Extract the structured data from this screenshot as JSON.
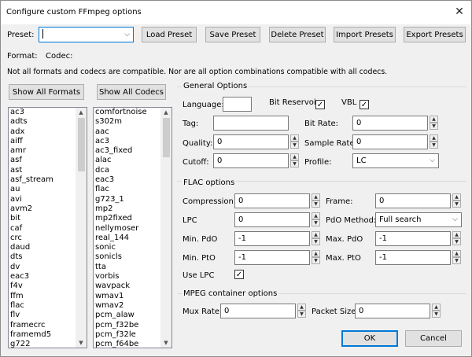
{
  "window": {
    "title": "Configure custom FFmpeg options",
    "close_glyph": "✕"
  },
  "preset": {
    "label": "Preset:",
    "value": "",
    "dropdown_glyph": "⌵"
  },
  "toolbar": {
    "load": "Load Preset",
    "save": "Save Preset",
    "delete": "Delete Preset",
    "import": "Import Presets",
    "export": "Export Presets"
  },
  "format_row": {
    "format_label": "Format:",
    "codec_label": "Codec:"
  },
  "notice": "Not all formats and codecs are compatible. Nor are all option combinations compatible with all codecs.",
  "lists": {
    "show_formats": "Show All Formats",
    "show_codecs": "Show All Codecs",
    "formats": [
      "ac3",
      "adts",
      "adx",
      "aiff",
      "amr",
      "asf",
      "ast",
      "asf_stream",
      "au",
      "avi",
      "avm2",
      "bit",
      "caf",
      "crc",
      "daud",
      "dts",
      "dv",
      "eac3",
      "f4v",
      "ffm",
      "flac",
      "flv",
      "framecrc",
      "framemd5",
      "g722"
    ],
    "codecs": [
      "comfortnoise",
      "s302m",
      "aac",
      "ac3",
      "ac3_fixed",
      "alac",
      "dca",
      "eac3",
      "flac",
      "g723_1",
      "mp2",
      "mp2fixed",
      "nellymoser",
      "real_144",
      "sonic",
      "sonicls",
      "tta",
      "vorbis",
      "wavpack",
      "wmav1",
      "wmav2",
      "pcm_alaw",
      "pcm_f32be",
      "pcm_f32le",
      "pcm_f64be"
    ]
  },
  "general": {
    "title": "General Options",
    "language_label": "Language:",
    "language_value": "",
    "bit_reservoir_label": "Bit Reservoir",
    "bit_reservoir_checked": "✓",
    "vbl_label": "VBL",
    "vbl_checked": "✓",
    "tag_label": "Tag:",
    "tag_value": "",
    "bitrate_label": "Bit Rate:",
    "bitrate_value": "0",
    "quality_label": "Quality:",
    "quality_value": "0",
    "samplerate_label": "Sample Rate:",
    "samplerate_value": "0",
    "cutoff_label": "Cutoff:",
    "cutoff_value": "0",
    "profile_label": "Profile:",
    "profile_value": "LC"
  },
  "flac": {
    "title": "FLAC options",
    "compression_label": "Compression:",
    "compression_value": "0",
    "frame_label": "Frame:",
    "frame_value": "0",
    "lpc_label": "LPC",
    "lpc_value": "0",
    "pdo_method_label": "PdO Method:",
    "pdo_method_value": "Full search",
    "min_pdo_label": "Min. PdO",
    "min_pdo_value": "-1",
    "max_pdo_label": "Max. PdO",
    "max_pdo_value": "-1",
    "min_pto_label": "Min. PtO",
    "min_pto_value": "-1",
    "max_pto_label": "Max. PtO",
    "max_pto_value": "-1",
    "use_lpc_label": "Use LPC",
    "use_lpc_checked": "✓"
  },
  "mpeg": {
    "title": "MPEG container options",
    "mux_rate_label": "Mux Rate:",
    "mux_rate_value": "0",
    "packet_size_label": "Packet Size:",
    "packet_size_value": "0"
  },
  "footer": {
    "ok": "OK",
    "cancel": "Cancel"
  },
  "icons": {
    "spin_up": "▲",
    "spin_down": "▼",
    "scroll_up": "▲",
    "scroll_down": "▼",
    "chevron": "⌵"
  }
}
